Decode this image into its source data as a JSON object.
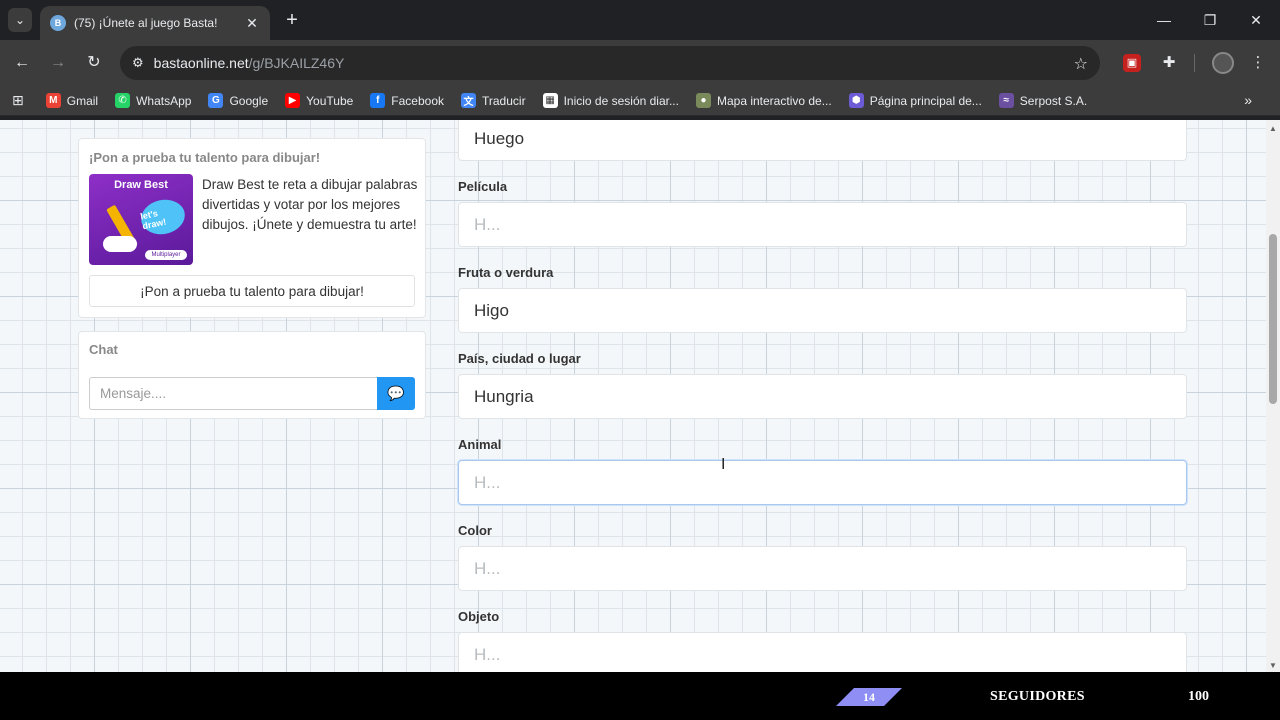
{
  "browser": {
    "tab_title": "(75) ¡Únete al juego Basta!",
    "tab_favicon": "B",
    "url_domain": "bastaonline.net",
    "url_path": "/g/BJKAILZ46Y",
    "bookmarks": [
      {
        "label": "Gmail",
        "icon": "gmail-icon",
        "color": "#ea4335",
        "glyph": "M"
      },
      {
        "label": "WhatsApp",
        "icon": "whatsapp-icon",
        "color": "#25d366",
        "glyph": "✆"
      },
      {
        "label": "Google",
        "icon": "google-icon",
        "color": "#4285f4",
        "glyph": "G"
      },
      {
        "label": "YouTube",
        "icon": "youtube-icon",
        "color": "#ff0000",
        "glyph": "▶"
      },
      {
        "label": "Facebook",
        "icon": "facebook-icon",
        "color": "#1877f2",
        "glyph": "f"
      },
      {
        "label": "Traducir",
        "icon": "translate-icon",
        "color": "#4285f4",
        "glyph": "文"
      },
      {
        "label": "Inicio de sesión diar...",
        "icon": "calendar-icon",
        "color": "#ffffff",
        "glyph": "▦"
      },
      {
        "label": "Mapa interactivo de...",
        "icon": "map-icon",
        "color": "#7a8a5a",
        "glyph": "●"
      },
      {
        "label": "Página principal de...",
        "icon": "hexagon-icon",
        "color": "#6b5bd6",
        "glyph": "⬢"
      },
      {
        "label": "Serpost S.A.",
        "icon": "serpost-icon",
        "color": "#6b4fa0",
        "glyph": "≈"
      }
    ]
  },
  "sidebar": {
    "promo_title": "¡Pon a prueba tu talento para dibujar!",
    "promo_image_title": "Draw Best",
    "promo_image_bubble": "let's draw!",
    "promo_image_logo": "Multiplayer",
    "promo_text": "Draw Best te reta a dibujar palabras divertidas y votar por los mejores dibujos. ¡Únete y demuestra tu arte!",
    "promo_button": "¡Pon a prueba tu talento para dibujar!",
    "chat_title": "Chat",
    "chat_placeholder": "Mensaje...."
  },
  "form": {
    "fields": [
      {
        "label": "",
        "value": "Huego",
        "placeholder": ""
      },
      {
        "label": "Película",
        "value": "",
        "placeholder": "H..."
      },
      {
        "label": "Fruta o verdura",
        "value": "Higo",
        "placeholder": ""
      },
      {
        "label": "País, ciudad o lugar",
        "value": "Hungria",
        "placeholder": ""
      },
      {
        "label": "Animal",
        "value": "",
        "placeholder": "H..."
      },
      {
        "label": "Color",
        "value": "",
        "placeholder": "H..."
      },
      {
        "label": "Objeto",
        "value": "",
        "placeholder": "H..."
      }
    ]
  },
  "overlay": {
    "badge": "14",
    "label": "SEGUIDORES",
    "count": "100"
  }
}
